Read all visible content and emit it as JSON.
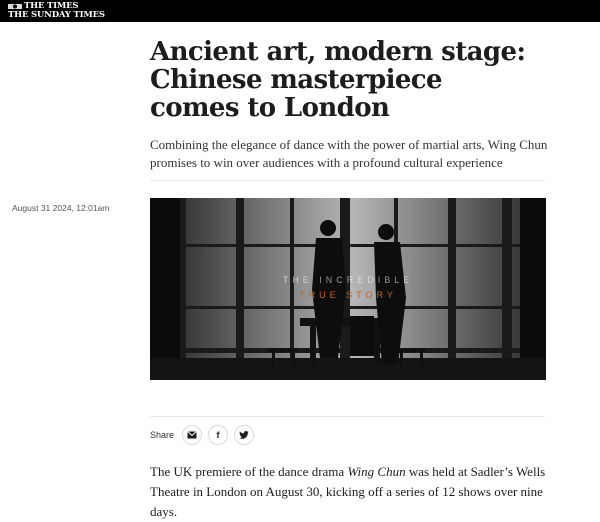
{
  "masthead": {
    "line1": "THE TIMES",
    "line2": "THE SUNDAY TIMES",
    "background": "#000000"
  },
  "article": {
    "headline": "Ancient art, modern stage: Chinese masterpiece comes to London",
    "headline_lines": [
      "Ancient art, modern stage:",
      "Chinese masterpiece",
      "comes to London"
    ],
    "standfirst": "Combining the elegance of dance with the power of martial arts, Wing Chun promises to win over audiences with a profound cultural experience",
    "dateline": "August 31 2024, 12:01am",
    "hero_overlay": {
      "line1": "THE INCREDIBLE",
      "line2": "TRUE STORY",
      "accent_color": "#c0642a"
    },
    "body": {
      "p1_before": "The UK premiere of the dance drama ",
      "p1_em": "Wing Chun",
      "p1_after": " was held at Sadler’s Wells Theatre in London on August 30, kicking off a series of 12 shows over nine days."
    }
  },
  "share": {
    "label": "Share",
    "buttons": [
      {
        "name": "email",
        "icon": "envelope-icon"
      },
      {
        "name": "facebook",
        "icon": "facebook-icon",
        "glyph": "f"
      },
      {
        "name": "twitter",
        "icon": "twitter-icon"
      }
    ]
  }
}
